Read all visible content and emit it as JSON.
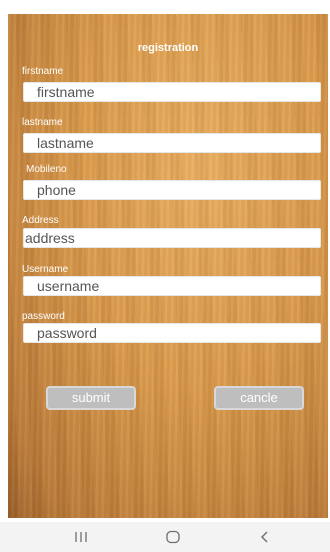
{
  "form": {
    "title": "registration",
    "fields": [
      {
        "label": "firstname",
        "value": "firstname"
      },
      {
        "label": "lastname",
        "value": "lastname"
      },
      {
        "label": "Mobileno",
        "value": "phone"
      },
      {
        "label": "Address",
        "value": "address"
      },
      {
        "label": "Username",
        "value": "username"
      },
      {
        "label": "password",
        "value": "password"
      }
    ],
    "submit_label": "submit",
    "cancel_label": "cancle"
  },
  "navbar": {
    "icons": [
      "recent-apps-icon",
      "home-icon",
      "back-icon"
    ]
  },
  "colors": {
    "wood_light": "#e9ad5f",
    "wood_dark": "#b97836",
    "button_bg": "#bebebe",
    "navbar_bg": "#f3f3f3"
  }
}
